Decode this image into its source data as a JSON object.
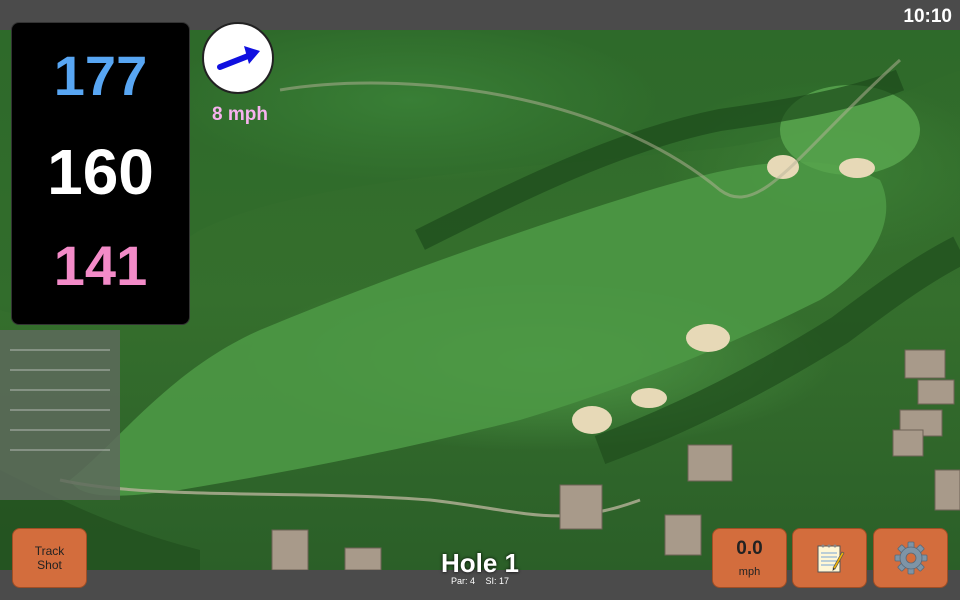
{
  "status": {
    "time": "10:10"
  },
  "yardages": {
    "back": "177",
    "middle": "160",
    "front": "141"
  },
  "wind": {
    "speed_label": "8 mph",
    "icon": "arrow-icon",
    "color": "#1010e0"
  },
  "buttons": {
    "track_shot_line1": "Track",
    "track_shot_line2": "Shot",
    "speed_value": "0.0",
    "speed_unit": "mph",
    "notes_icon": "notepad-icon",
    "settings_icon": "gear-icon"
  },
  "hole": {
    "title": "Hole 1",
    "par": "Par: 4",
    "si": "SI: 17"
  },
  "colors": {
    "back": "#58a6f3",
    "middle": "#ffffff",
    "front": "#f38bc8",
    "wind_label": "#f7b2ef",
    "button": "#d36d3d"
  }
}
